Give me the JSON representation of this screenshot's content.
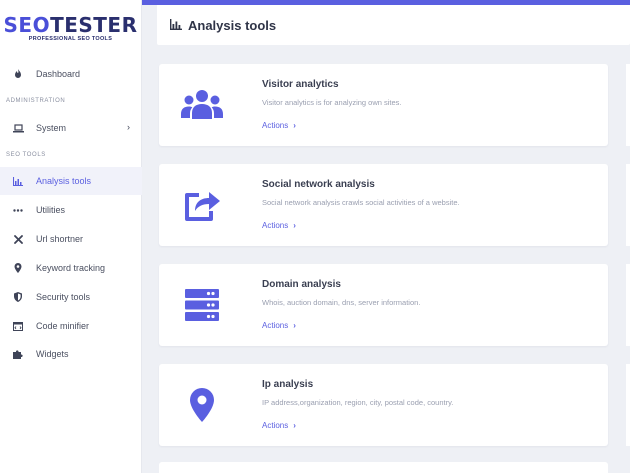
{
  "brand": {
    "name_part1": "SEO",
    "name_part2": "TESTER",
    "tagline": "PROFESSIONAL SEO TOOLS"
  },
  "sidebar": {
    "items_top": [
      {
        "label": "Dashboard",
        "icon": "fire-icon"
      }
    ],
    "section_admin": "ADMINISTRATION",
    "items_admin": [
      {
        "label": "System",
        "icon": "laptop-icon",
        "has_submenu": true
      }
    ],
    "section_tools": "SEO TOOLS",
    "items_tools": [
      {
        "label": "Analysis tools",
        "icon": "bar-chart-icon",
        "active": true
      },
      {
        "label": "Utilities",
        "icon": "ellipsis-icon"
      },
      {
        "label": "Url shortner",
        "icon": "tools-icon"
      },
      {
        "label": "Keyword tracking",
        "icon": "map-pin-icon"
      },
      {
        "label": "Security tools",
        "icon": "shield-icon"
      },
      {
        "label": "Code minifier",
        "icon": "code-icon"
      },
      {
        "label": "Widgets",
        "icon": "puzzle-icon"
      }
    ]
  },
  "header": {
    "title": "Analysis tools",
    "icon": "bar-chart-icon"
  },
  "cards": [
    {
      "title": "Visitor analytics",
      "description": "Visitor analytics is for analyzing own sites.",
      "action": "Actions",
      "icon": "users-icon"
    },
    {
      "title": "Social network analysis",
      "description": "Social network analysis crawls social activities of a website.",
      "action": "Actions",
      "icon": "share-icon"
    },
    {
      "title": "Domain analysis",
      "description": "Whois, auction domain, dns, server information.",
      "action": "Actions",
      "icon": "server-icon"
    },
    {
      "title": "Ip analysis",
      "description": "IP address,organization, region, city, postal code, country.",
      "action": "Actions",
      "icon": "map-marker-icon"
    }
  ],
  "colors": {
    "accent": "#5a5fe0",
    "sidebar_bg": "#ffffff",
    "page_bg": "#eef0f5"
  }
}
